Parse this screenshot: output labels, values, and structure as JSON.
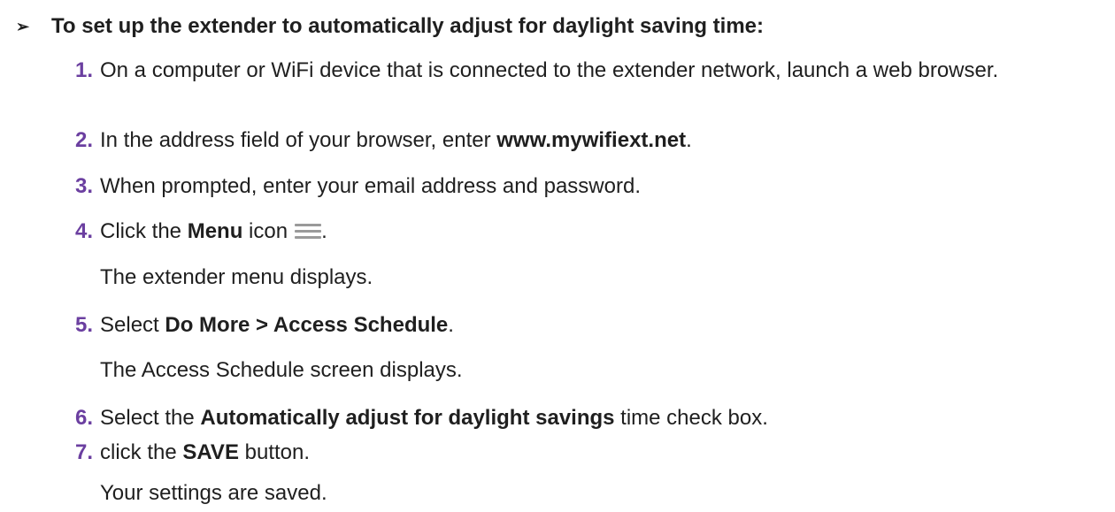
{
  "heading": {
    "arrow": "➢",
    "text": "To set up the extender to automatically adjust for daylight saving time:"
  },
  "steps": [
    {
      "num": "1.",
      "text": "On a computer or WiFi device that is connected to the extender network, launch a web browser."
    },
    {
      "num": "2.",
      "pre": "In the address field of your browser, enter ",
      "bold": "www.mywifiext.net",
      "post": "."
    },
    {
      "num": "3.",
      "text": "When prompted, enter your email address and password."
    },
    {
      "num": "4.",
      "pre": "Click the ",
      "bold": "Menu",
      "post": " icon",
      "end": ".",
      "icon": "menu-icon"
    },
    {
      "note": "The extender menu displays."
    },
    {
      "num": "5.",
      "pre": "Select ",
      "bold": "Do More > Access Schedule",
      "post": "."
    },
    {
      "note": "The Access Schedule screen displays."
    },
    {
      "num": "6.",
      "pre": "Select the ",
      "bold": "Automatically adjust for daylight savings",
      "post": " time check box."
    },
    {
      "num": "7.",
      "pre": "click the ",
      "bold": "SAVE",
      "post": " button."
    },
    {
      "note": "Your settings are saved."
    }
  ]
}
